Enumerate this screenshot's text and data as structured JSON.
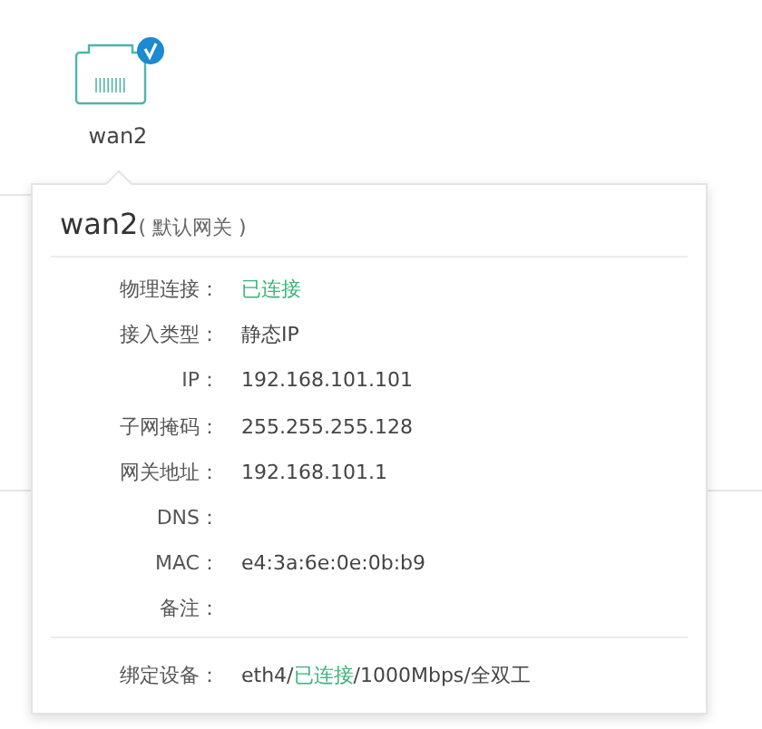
{
  "port": {
    "label": "wan2",
    "connected": true
  },
  "popover": {
    "title": "wan2",
    "subtitle": "( 默认网关 )",
    "rows": [
      {
        "label": "物理连接：",
        "kind": "status",
        "value": "已连接"
      },
      {
        "label": "接入类型：",
        "kind": "text",
        "value": "静态IP"
      },
      {
        "label": "IP：",
        "kind": "text",
        "value": "192.168.101.101"
      },
      {
        "label": "子网掩码：",
        "kind": "text",
        "value": "255.255.255.128"
      },
      {
        "label": "网关地址：",
        "kind": "text",
        "value": "192.168.101.1"
      },
      {
        "label": "DNS："
      },
      {
        "label": "MAC：",
        "kind": "text",
        "value": "e4:3a:6e:0e:0b:b9"
      },
      {
        "label": "备注："
      }
    ],
    "bound": {
      "label": "绑定设备：",
      "parts": [
        {
          "kind": "text",
          "text": "eth4/"
        },
        {
          "kind": "status",
          "text": "已连接"
        },
        {
          "kind": "text",
          "text": "/1000Mbps/全双工"
        }
      ]
    }
  }
}
